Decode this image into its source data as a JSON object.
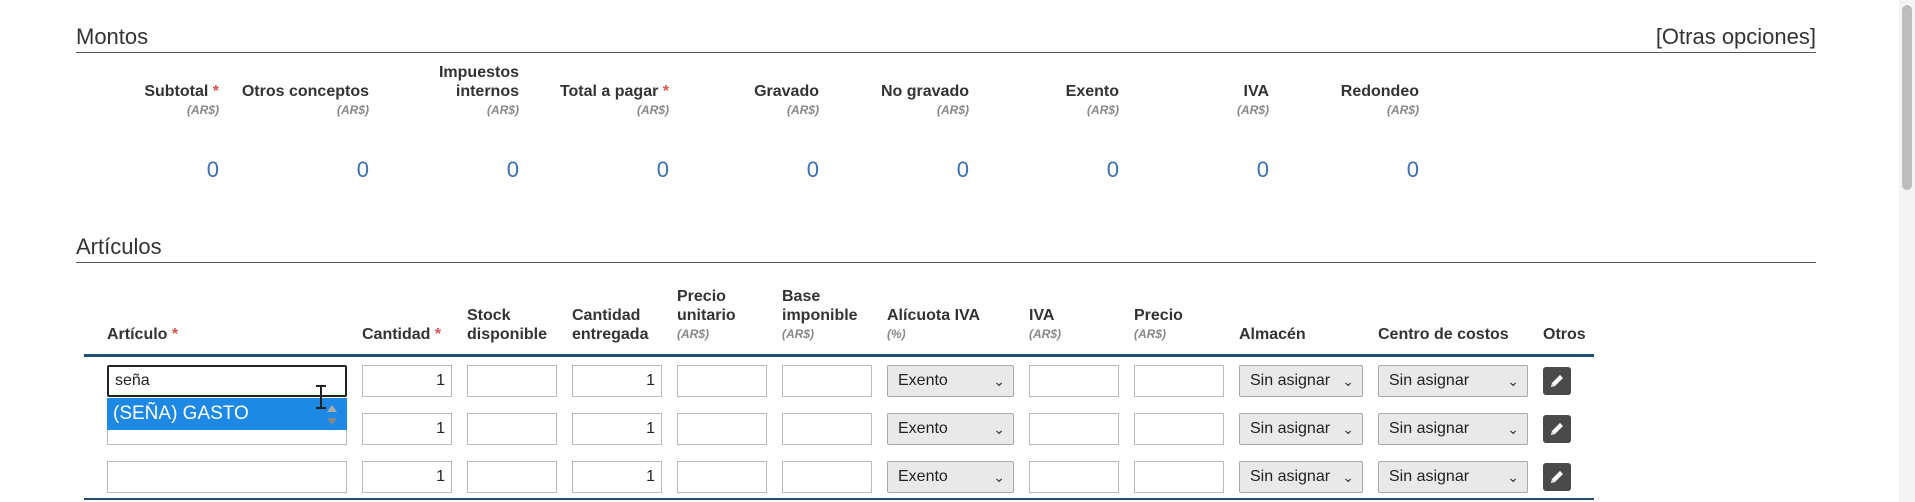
{
  "montos": {
    "title": "Montos",
    "other_options": "[Otras opciones]",
    "columns": [
      {
        "label_lines": [
          "Subtotal"
        ],
        "required": true,
        "unit": "(AR$)",
        "value": "0"
      },
      {
        "label_lines": [
          "Otros conceptos"
        ],
        "required": false,
        "unit": "(AR$)",
        "value": "0"
      },
      {
        "label_lines": [
          "Impuestos",
          "internos"
        ],
        "required": false,
        "unit": "(AR$)",
        "value": "0"
      },
      {
        "label_lines": [
          "Total a pagar"
        ],
        "required": true,
        "unit": "(AR$)",
        "value": "0"
      },
      {
        "label_lines": [
          "Gravado"
        ],
        "required": false,
        "unit": "(AR$)",
        "value": "0"
      },
      {
        "label_lines": [
          "No gravado"
        ],
        "required": false,
        "unit": "(AR$)",
        "value": "0"
      },
      {
        "label_lines": [
          "Exento"
        ],
        "required": false,
        "unit": "(AR$)",
        "value": "0"
      },
      {
        "label_lines": [
          "IVA"
        ],
        "required": false,
        "unit": "(AR$)",
        "value": "0"
      },
      {
        "label_lines": [
          "Redondeo"
        ],
        "required": false,
        "unit": "(AR$)",
        "value": "0"
      }
    ]
  },
  "articulos": {
    "title": "Artículos",
    "headers": [
      {
        "lines": [
          "Artículo"
        ],
        "required": true,
        "unit": ""
      },
      {
        "lines": [
          "Cantidad"
        ],
        "required": true,
        "unit": ""
      },
      {
        "lines": [
          "Stock",
          "disponible"
        ],
        "required": false,
        "unit": ""
      },
      {
        "lines": [
          "Cantidad",
          "entregada"
        ],
        "required": false,
        "unit": ""
      },
      {
        "lines": [
          "Precio",
          "unitario"
        ],
        "required": false,
        "unit": "(AR$)"
      },
      {
        "lines": [
          "Base",
          "imponible"
        ],
        "required": false,
        "unit": "(AR$)"
      },
      {
        "lines": [
          "Alícuota IVA"
        ],
        "required": false,
        "unit": "(%)"
      },
      {
        "lines": [
          "IVA"
        ],
        "required": false,
        "unit": "(AR$)"
      },
      {
        "lines": [
          "Precio"
        ],
        "required": false,
        "unit": "(AR$)"
      },
      {
        "lines": [
          "Almacén"
        ],
        "required": false,
        "unit": ""
      },
      {
        "lines": [
          "Centro de costos"
        ],
        "required": false,
        "unit": ""
      },
      {
        "lines": [
          "Otros"
        ],
        "required": false,
        "unit": ""
      }
    ],
    "rows": [
      {
        "articulo": "seña",
        "cantidad": "1",
        "stock": "",
        "entregada": "1",
        "precio_unitario": "",
        "base_imponible": "",
        "alicuota": "Exento",
        "iva": "",
        "precio": "",
        "almacen": "Sin asignar",
        "centro": "Sin asignar"
      },
      {
        "articulo": "",
        "cantidad": "1",
        "stock": "",
        "entregada": "1",
        "precio_unitario": "",
        "base_imponible": "",
        "alicuota": "Exento",
        "iva": "",
        "precio": "",
        "almacen": "Sin asignar",
        "centro": "Sin asignar"
      },
      {
        "articulo": "",
        "cantidad": "1",
        "stock": "",
        "entregada": "1",
        "precio_unitario": "",
        "base_imponible": "",
        "alicuota": "Exento",
        "iva": "",
        "precio": "",
        "almacen": "Sin asignar",
        "centro": "Sin asignar"
      }
    ],
    "autocomplete": {
      "option": "(SEÑA) GASTO"
    }
  },
  "colors": {
    "accent": "#1e88e5",
    "value": "#3a6fb0",
    "required": "#d9534f",
    "table_line": "#1f4e79"
  }
}
